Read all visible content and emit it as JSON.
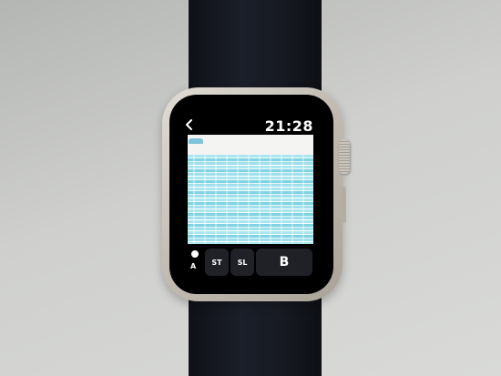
{
  "status_bar": {
    "time": "21:28",
    "back_icon": "chevron-left-icon"
  },
  "controls": {
    "a_label": "A",
    "start_label": "ST",
    "select_label": "SL",
    "b_label": "B"
  },
  "colors": {
    "screen_background": "#000000",
    "button_background": "#1f2127",
    "text": "#ffffff",
    "water_light": "#a9e6ef",
    "water_mid": "#7fd3e2",
    "sky": "#f4f5f2"
  }
}
